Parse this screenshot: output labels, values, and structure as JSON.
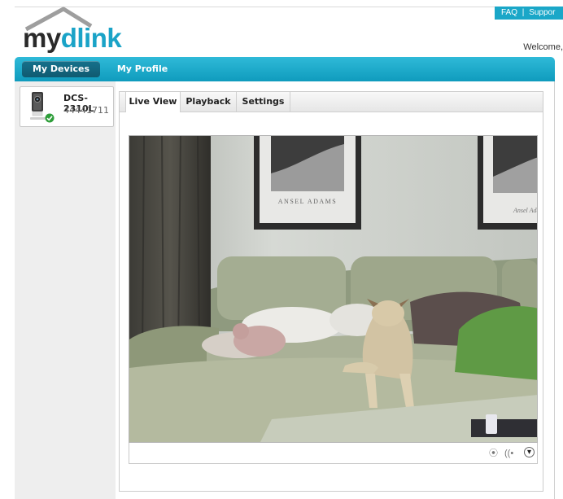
{
  "header": {
    "faq_label": "FAQ",
    "separator": "|",
    "support_label": "Suppor",
    "welcome_text": "Welcome,",
    "logo_text": "mydlink",
    "logo_colors": {
      "my": "#2a2a2a",
      "dlink": "#1aa3c7"
    }
  },
  "nav": {
    "tabs": [
      {
        "label": "My Devices",
        "active": true
      },
      {
        "label": "My Profile",
        "active": false
      }
    ]
  },
  "sidebar": {
    "devices": [
      {
        "name": "DCS-2310L",
        "id": "44441711",
        "status": "online",
        "icon": "camera-icon"
      }
    ]
  },
  "panel": {
    "tabs": [
      {
        "label": "Live View",
        "active": true
      },
      {
        "label": "Playback",
        "active": false
      },
      {
        "label": "Settings",
        "active": false
      }
    ],
    "video": {
      "poster_left_caption": "ANSEL ADAMS",
      "poster_right_caption": "Ansel Adams"
    },
    "controls": [
      {
        "icon": "record-icon",
        "glyph": "⦿"
      },
      {
        "icon": "audio-icon",
        "glyph": "((•"
      },
      {
        "icon": "dropdown-icon",
        "glyph": "▾"
      }
    ]
  },
  "colors": {
    "accent": "#1aa7c8",
    "nav_active": "#146a83",
    "status_ok": "#2e9e3a"
  }
}
